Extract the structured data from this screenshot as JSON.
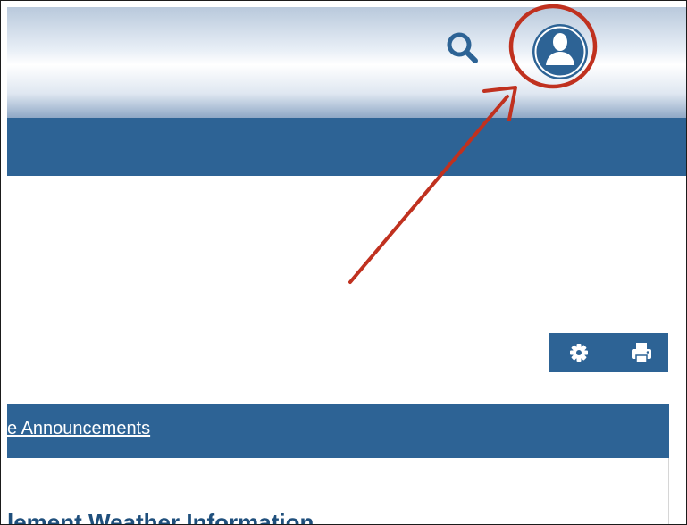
{
  "header": {
    "search_icon": "search-icon",
    "account_icon": "user-account-icon"
  },
  "toolbar": {
    "settings_icon": "gear-icon",
    "print_icon": "printer-icon"
  },
  "announcements": {
    "link_text": "e Announcements"
  },
  "content": {
    "title": "lement Weather Information"
  },
  "colors": {
    "primary_blue": "#2d6395",
    "dark_blue_text": "#1f4f7c",
    "annotation_red": "#c0311f"
  }
}
